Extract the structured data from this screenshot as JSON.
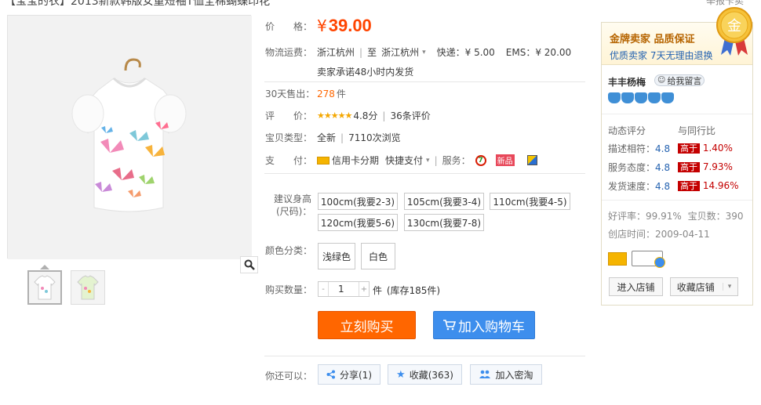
{
  "title_fragment": "【宝宝的衣】2013新款韩版女童短袖T恤全棉蝴蝶印花",
  "top_right_text": "举报卡卖",
  "price": {
    "label": "价　　格：",
    "currency": "¥",
    "value": "39.00"
  },
  "shipping": {
    "label": "物流运费：",
    "from": "浙江杭州",
    "to_prefix": "至",
    "to": "浙江杭州",
    "express": "快递：¥ 5.00",
    "ems": "EMS：¥ 20.00",
    "promise": "卖家承诺48小时内发货"
  },
  "sales": {
    "label": "30天售出：",
    "value": "278",
    "unit": "件"
  },
  "rating": {
    "label": "评　　价：",
    "stars": "★★★★★",
    "score": "4.8分",
    "reviews": "36条评价"
  },
  "item_type": {
    "label": "宝贝类型：",
    "value": "全新",
    "views": "7110次浏览"
  },
  "payment": {
    "label": "支　　付：",
    "credit": "信用卡分期",
    "quick": "快捷支付",
    "service_label": "服务：",
    "new_badge": "新品"
  },
  "size": {
    "label_line1": "建议身高",
    "label_line2": "(尺码)：",
    "options": [
      "100cm(我要2-3)",
      "105cm(我要3-4)",
      "110cm(我要4-5)",
      "120cm(我要5-6)",
      "130cm(我要7-8)"
    ]
  },
  "color": {
    "label": "颜色分类：",
    "options": [
      "浅绿色",
      "白色"
    ]
  },
  "quantity": {
    "label": "购买数量：",
    "value": "1",
    "unit": "件",
    "stock": "(库存185件)",
    "minus": "-",
    "plus": "+"
  },
  "buttons": {
    "buy_now": "立刻购买",
    "add_cart": "加入购物车"
  },
  "actions": {
    "label": "你还可以：",
    "share": "分享(1)",
    "favorite": "收藏(363)",
    "join": "加入密淘"
  },
  "shop": {
    "gold_line1": "金牌卖家 品质保证",
    "gold_line2": "优质卖家 7天无理由退换",
    "medal_text": "金",
    "name": "丰丰杨梅",
    "message": "给我留言",
    "crowns": 5,
    "dynamic_label": "动态评分",
    "compare_label": "与同行比",
    "scores": [
      {
        "label": "描述相符：",
        "value": "4.8",
        "badge": "高于",
        "pct": "1.40%"
      },
      {
        "label": "服务态度：",
        "value": "4.8",
        "badge": "高于",
        "pct": "7.93%"
      },
      {
        "label": "发货速度：",
        "value": "4.8",
        "badge": "高于",
        "pct": "14.96%"
      }
    ],
    "good_rate": "好评率：99.91%",
    "item_count": "宝贝数：390",
    "open_date": "创店时间：2009-04-11",
    "enter_shop": "进入店铺",
    "fav_shop": "收藏店铺"
  },
  "colors": {
    "price": "#ff4400",
    "buy": "#ff6600",
    "cart": "#3d8eed",
    "accent_blue": "#2462b0",
    "badge_red": "#c40000"
  }
}
